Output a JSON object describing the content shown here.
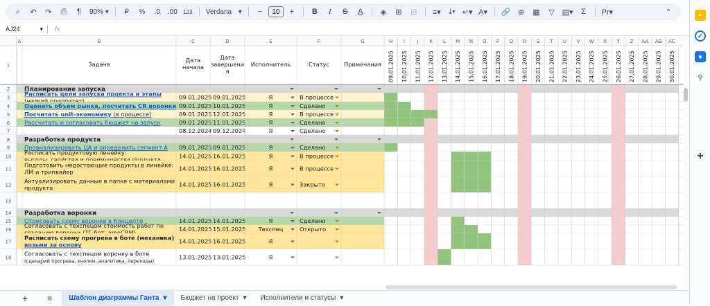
{
  "toolbar": {
    "zoom": "90%",
    "percent": "%",
    "dec_minus": ".0",
    "dec_plus": ".00",
    "num_format": "123",
    "font": "Verdana",
    "font_size": "10",
    "minus": "−",
    "plus": "+"
  },
  "namebox": "AJ24",
  "fx": "fx",
  "col_letters": [
    "A",
    "B",
    "C",
    "D",
    "E",
    "F",
    "G",
    "H",
    "I",
    "J",
    "K",
    "L",
    "M",
    "N",
    "O",
    "P",
    "Q",
    "R",
    "S",
    "T",
    "U",
    "V",
    "W",
    "X",
    "Y",
    "Z",
    "AA",
    "AB",
    "AC"
  ],
  "headers": [
    "Задача",
    "Дата начала",
    "Дата завершения",
    "Исполнитель",
    "Статус",
    "Примечания"
  ],
  "header_c": [
    "Дата",
    "начала"
  ],
  "header_d": [
    "Дата",
    "завершени",
    "я"
  ],
  "dates": [
    "09.01.2025",
    "10.01.2025",
    "11.01.2025",
    "12.01.2025",
    "13.01.2025",
    "14.01.2025",
    "15.01.2025",
    "16.01.2025",
    "17.01.2025",
    "18.01.2025",
    "19.01.2025",
    "20.01.2025",
    "21.01.2025",
    "22.01.2025",
    "23.01.2025",
    "24.01.2025",
    "25.01.2025",
    "26.01.2025",
    "27.01.2025",
    "28.01.2025",
    "29.01.2025",
    "30.01.2025"
  ],
  "rows": [
    {
      "num": "2",
      "type": "section",
      "task": [
        "Планирование запуска"
      ],
      "start": "",
      "end": "",
      "who": "",
      "status": ""
    },
    {
      "num": "3",
      "type": "task",
      "bg": "#fff2cc",
      "task": [
        "Расписать цели запуска проекта и этапы",
        "(низкий приоритет)"
      ],
      "link_lines": 1,
      "bold_link": true,
      "start": "09.01.2025",
      "end": "09.01.2025",
      "who": "Я",
      "status": "В процессе",
      "bars": [
        0
      ]
    },
    {
      "num": "4",
      "type": "task",
      "bg": "#b6d7a8",
      "task": [
        "Оценить объем рынка, посчитать CR воронки"
      ],
      "link_lines": 1,
      "bold_link": true,
      "start": "09.01.2025",
      "end": "10.01.2025",
      "who": "Я",
      "status": "Сделано",
      "bars": [
        0,
        1
      ]
    },
    {
      "num": "5",
      "type": "task",
      "bg": "#fff2cc",
      "task": [
        "Посчитать unit-экономику"
      ],
      "suffix": " (в процессе)",
      "link_lines": 1,
      "bold_link": true,
      "start": "09.01.2025",
      "end": "12.01.2025",
      "who": "Я",
      "status": "В процессе",
      "bars": [
        0,
        1,
        2,
        3
      ]
    },
    {
      "num": "6",
      "type": "task",
      "bg": "#b6d7a8",
      "task": [
        "Рассчитать и согласовать бюджет на запуск"
      ],
      "link_lines": 1,
      "start": "09.01.2025",
      "end": "11.01.2025",
      "who": "Я",
      "status": "Сделано",
      "bars": [
        0,
        1,
        2
      ]
    },
    {
      "num": "7",
      "type": "task",
      "bg": "#ffffff",
      "task": [
        ""
      ],
      "start": "08.12.2024",
      "end": "09.12.2024",
      "who": "Я",
      "status": "Сделано",
      "bars": []
    },
    {
      "num": "8",
      "type": "section",
      "task": [
        "Разработка продукта"
      ],
      "start": "",
      "end": "",
      "who": "",
      "status": ""
    },
    {
      "num": "9",
      "type": "task",
      "bg": "#b6d7a8",
      "task": [
        "Проанализировать ЦА и определить сегмент А"
      ],
      "link_lines": 1,
      "start": "09.01.2025",
      "end": "09.01.2025",
      "who": "Я",
      "status": "Сделано",
      "bars": [
        0
      ]
    },
    {
      "num": "10",
      "type": "task",
      "bg": "#ffe599",
      "task": [
        "Расписать продуктовую линейку:",
        "выгоды, свойства и преимущества продукта"
      ],
      "start": "14.01.2025",
      "end": "16.01.2025",
      "who": "Я",
      "status": "В процессе",
      "bars": [
        5,
        6,
        7
      ]
    },
    {
      "num": "11",
      "type": "task",
      "bg": "#ffe599",
      "task": [
        "Подготовить недостающие продукты в линейке:",
        "ЛМ и трипвайер"
      ],
      "start": "14.01.2025",
      "end": "16.01.2025",
      "who": "Я",
      "status": "В процессе",
      "bars": [
        5,
        6,
        7
      ]
    },
    {
      "num": "12",
      "type": "task",
      "bg": "#ffe599",
      "task": [
        "Актуализировать данные в папке с материалами",
        "продукта"
      ],
      "start": "14.01.2025",
      "end": "16.01.2025",
      "who": "Я",
      "status": "Закрыто",
      "bars": [
        5,
        6,
        7
      ]
    },
    {
      "num": "13",
      "type": "task",
      "bg": "#ffffff",
      "task": [
        ""
      ],
      "start": "",
      "end": "",
      "who": "",
      "status": "",
      "bars": []
    },
    {
      "num": "14",
      "type": "section",
      "task": [
        "Разработка воронки"
      ],
      "start": "",
      "end": "",
      "who": "",
      "status": ""
    },
    {
      "num": "15",
      "type": "task",
      "bg": "#b6d7a8",
      "task": [
        "Отрисовать схему воронки в Концепте"
      ],
      "link_lines": 1,
      "start": "14.01.2025",
      "end": "14.01.2025",
      "who": "Я",
      "status": "Сделано",
      "bars": [
        5
      ]
    },
    {
      "num": "16",
      "type": "task",
      "bg": "#ffe599",
      "task": [
        "Согласовать с техспецом стоимость работ по",
        "созданию воронки (ТГ-бот, amoCRM)"
      ],
      "start": "14.01.2025",
      "end": "15.01.2025",
      "who": "Техспец",
      "status": "Открыто",
      "bars": [
        5,
        6
      ]
    },
    {
      "num": "17",
      "type": "task",
      "bg": "#ffe599",
      "task": [
        "Расписать схему прогрева в боте (механика)",
        "возьми за основу"
      ],
      "bold_first": true,
      "link_second": true,
      "start": "14.01.2025",
      "end": "16.01.2025",
      "who": "Я",
      "status": "",
      "bars": [
        5,
        6,
        7
      ]
    },
    {
      "num": "18",
      "type": "task",
      "bg": "#ffffff",
      "task": [
        "Согласовать с техспецом воронку в боте",
        "(сценарий прогрева, кнопки, аналитика, переходы)"
      ],
      "small_second": true,
      "start": "13.01.2025",
      "end": "13.01.2025",
      "who": "Я",
      "status": "",
      "bars": [
        4
      ]
    }
  ],
  "tabs": [
    "Шаблон диаграммы Ганта",
    "Бюджет на проект",
    "Исполнители и статусы"
  ],
  "colors": {
    "section": "#d9d9d9",
    "done": "#b6d7a8",
    "progress": "#fff2cc",
    "yellow": "#ffe599",
    "bar": "#93c47d",
    "weekend": "#f4cccc",
    "link": "#1155cc",
    "header": "#f8f9fa"
  }
}
